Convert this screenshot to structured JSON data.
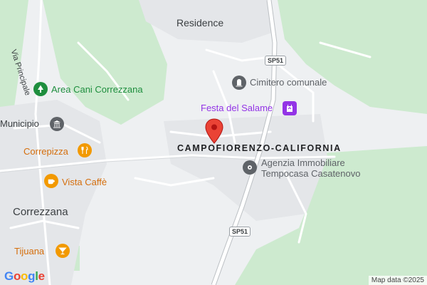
{
  "map": {
    "place_labels": {
      "residence": "Residence",
      "correzzana": "Correzzana",
      "municipio": "Municipio",
      "district": "CAMPOFIORENZO-CALIFORNIA"
    },
    "road_labels": {
      "via_principale": "Via Principale",
      "sp51_top": "SP51",
      "sp51_bottom": "SP51"
    },
    "pois": {
      "area_cani": {
        "label": "Area Cani Correzzana",
        "icon": "tree-icon",
        "color": "#1e8e3e"
      },
      "cimitero": {
        "label": "Cimitero comunale",
        "icon": "cemetery-icon",
        "color": "#5f6368"
      },
      "festa": {
        "label": "Festa del Salame",
        "icon": "event-icon",
        "color": "#9334e6"
      },
      "agenzia": {
        "label_line1": "Agenzia Immobiliare",
        "label_line2": "Tempocasa Casatenovo",
        "icon": "business-icon",
        "color": "#5f6368"
      },
      "correpizza": {
        "label": "Correpizza",
        "icon": "restaurant-icon",
        "color": "#f29900"
      },
      "vista_caffe": {
        "label": "Vista Caffè",
        "icon": "cafe-icon",
        "color": "#f29900"
      },
      "tijuana": {
        "label": "Tijuana",
        "icon": "bar-icon",
        "color": "#f29900"
      },
      "municipio": {
        "icon": "town-hall-icon",
        "color": "#5f6368"
      }
    },
    "marker": {
      "icon": "location-pin-icon",
      "color": "#ea4335"
    },
    "logo": "Google",
    "attribution": "Map data ©2025",
    "colors": {
      "land": "#eef0f2",
      "park": "#cdeacf",
      "road": "#ffffff",
      "highway": "#ffffff"
    }
  }
}
